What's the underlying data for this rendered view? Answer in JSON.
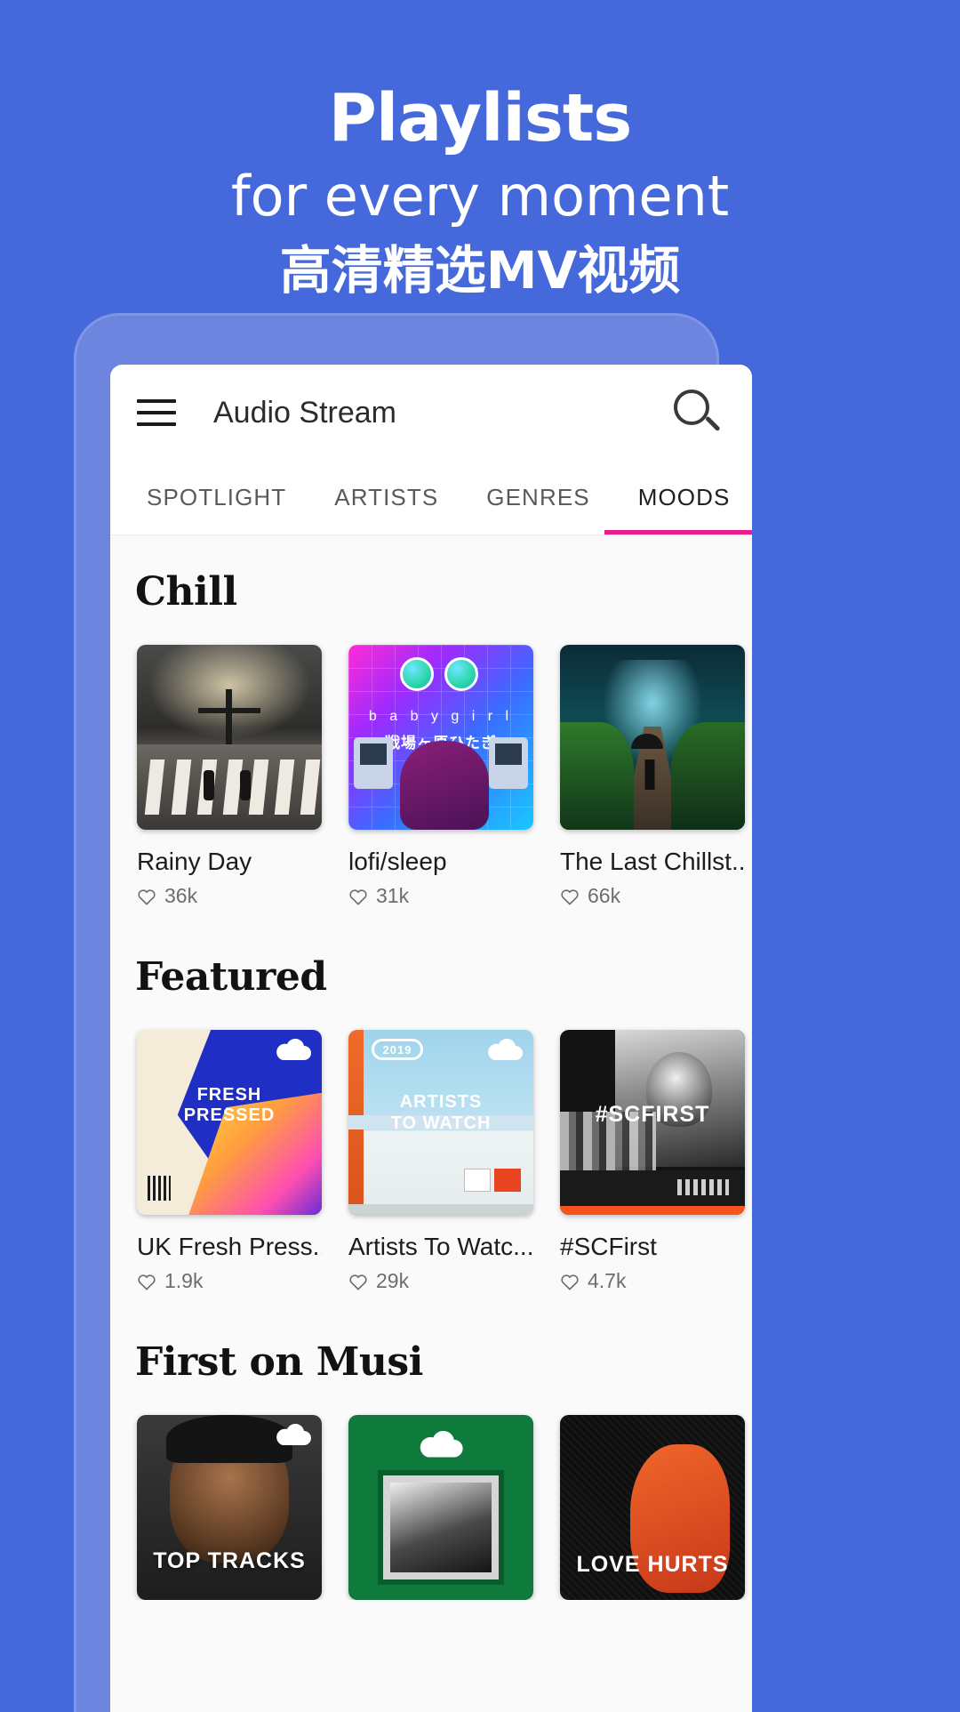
{
  "promo": {
    "line1": "Playlists",
    "line2": "for every moment",
    "line3": "高清精选MV视频"
  },
  "colors": {
    "background": "#4569da",
    "phone_shell": "#6e85e0",
    "tab_indicator": "#e91e8c",
    "screen": "#fafafa"
  },
  "appbar": {
    "menu_icon": "hamburger-menu-icon",
    "title": "Audio Stream",
    "search_icon": "search-icon"
  },
  "tabs": [
    {
      "label": "SPOTLIGHT",
      "active": false
    },
    {
      "label": "ARTISTS",
      "active": false
    },
    {
      "label": "GENRES",
      "active": false
    },
    {
      "label": "MOODS",
      "active": true
    }
  ],
  "sections": [
    {
      "title": "Chill",
      "cards": [
        {
          "title": "Rainy Day",
          "likes": "36k",
          "art": "rainy-street-photo"
        },
        {
          "title": "lofi/sleep",
          "likes": "31k",
          "art": "vaporwave-anime-art",
          "overlay_text": "b a b y   g i r l",
          "overlay_sub": "戦場ヶ原ひたぎ"
        },
        {
          "title": "The Last Chillst...",
          "likes": "66k",
          "art": "forest-path-umbrella-photo"
        }
      ]
    },
    {
      "title": "Featured",
      "cards": [
        {
          "title": "UK Fresh Press...",
          "likes": "1.9k",
          "art": "fresh-pressed-cover",
          "overlay_text": "FRESH\nPRESSED",
          "badge": ""
        },
        {
          "title": "Artists To Watc...",
          "likes": "29k",
          "art": "artists-to-watch-cover",
          "overlay_text": "ARTISTS\nTO WATCH",
          "badge": "2019"
        },
        {
          "title": "#SCFirst",
          "likes": "4.7k",
          "art": "scfirst-cover",
          "overlay_text": "#SCFIRST"
        }
      ]
    },
    {
      "title": "First on Musi",
      "cards": [
        {
          "title": "",
          "likes": "",
          "art": "top-tracks-cover",
          "overlay_text": "TOP TRACKS"
        },
        {
          "title": "",
          "likes": "",
          "art": "green-frame-cover",
          "overlay_text": ""
        },
        {
          "title": "",
          "likes": "",
          "art": "love-hurts-cover",
          "overlay_text": "LOVE HURTS"
        }
      ]
    }
  ],
  "icons": {
    "heart": "heart-outline-icon",
    "cloud": "soundcloud-cloud-icon"
  }
}
